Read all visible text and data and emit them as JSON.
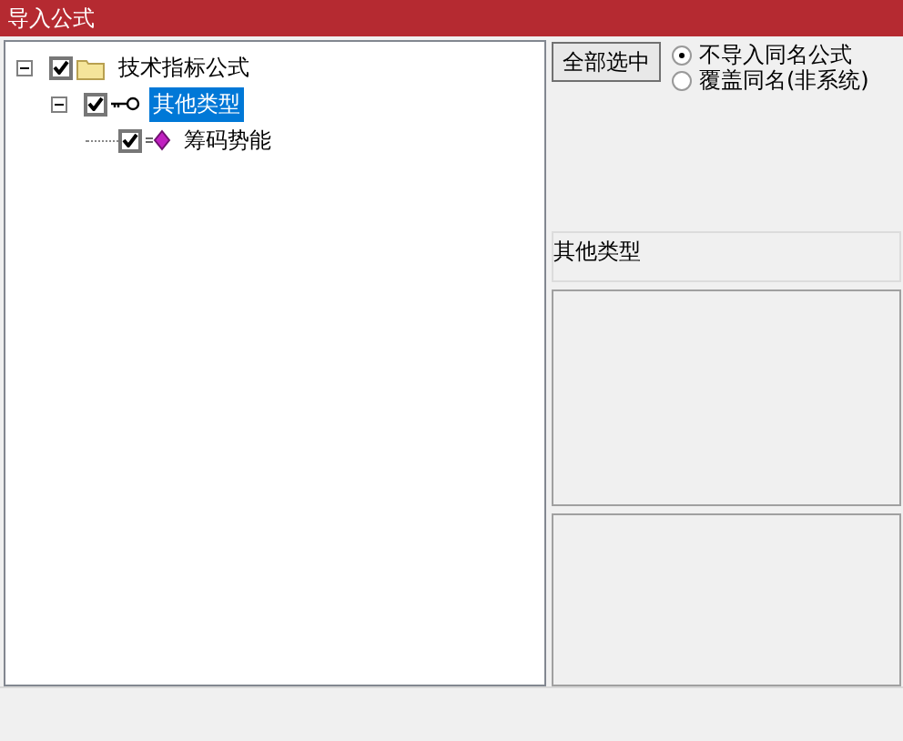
{
  "window": {
    "title": "导入公式"
  },
  "tree": [
    {
      "label": "技术指标公式",
      "kind": "folder",
      "expanded": true,
      "checked": true,
      "selected": false,
      "children": [
        {
          "label": "其他类型",
          "kind": "key",
          "expanded": true,
          "checked": true,
          "selected": true,
          "children": [
            {
              "label": "筹码势能",
              "kind": "formula",
              "checked": true,
              "selected": false
            }
          ]
        }
      ]
    }
  ],
  "select_all_button": "全部选中",
  "options": [
    {
      "label": "不导入同名公式",
      "selected": true
    },
    {
      "label": "覆盖同名(非系统)",
      "selected": false
    }
  ],
  "category_label": "其他类型"
}
